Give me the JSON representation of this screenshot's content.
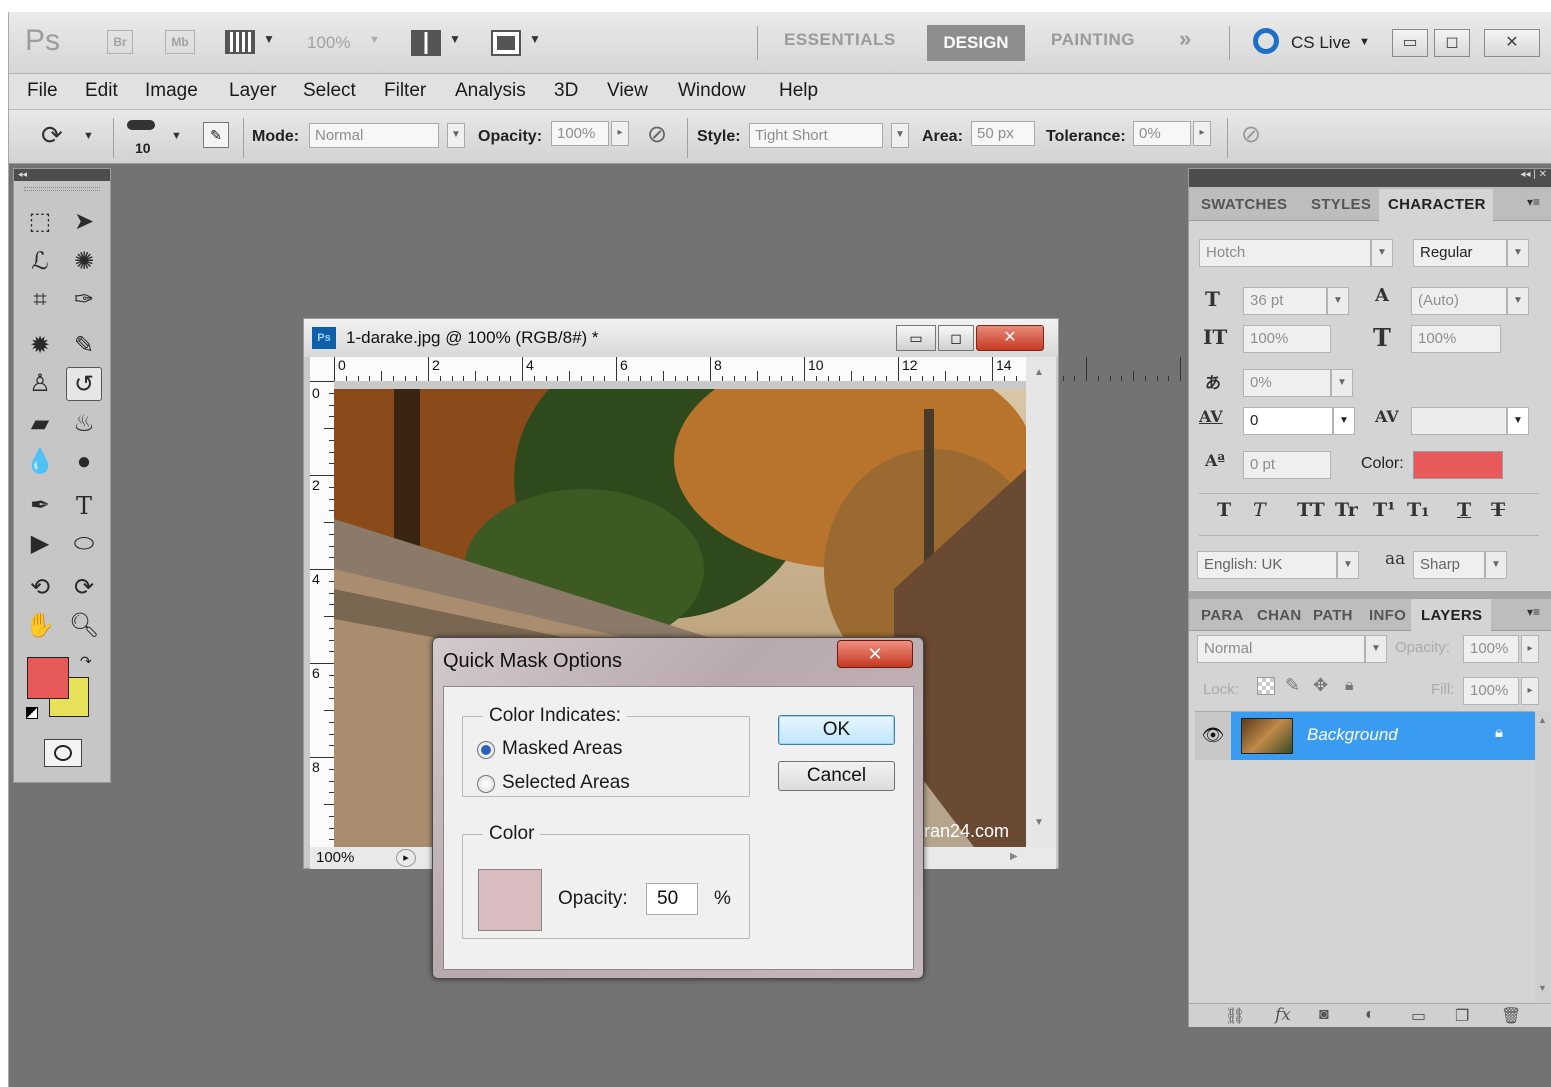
{
  "appbar": {
    "logo": "Ps",
    "bridge": "Br",
    "minibridge": "Mb",
    "zoom": "100%",
    "workspaces": [
      "ESSENTIALS",
      "DESIGN",
      "PAINTING"
    ],
    "more": "»",
    "cslive": "CS Live"
  },
  "menu": [
    "File",
    "Edit",
    "Image",
    "Layer",
    "Select",
    "Filter",
    "Analysis",
    "3D",
    "View",
    "Window",
    "Help"
  ],
  "options": {
    "brush_size": "10",
    "mode_label": "Mode:",
    "mode_value": "Normal",
    "opacity_label": "Opacity:",
    "opacity_value": "100%",
    "style_label": "Style:",
    "style_value": "Tight Short",
    "area_label": "Area:",
    "area_value": "50 px",
    "tolerance_label": "Tolerance:",
    "tolerance_value": "0%"
  },
  "document": {
    "title": "1-darake.jpg @ 100% (RGB/8#) *",
    "zoom": "100%",
    "ruler_h": [
      "0",
      "2",
      "4",
      "6",
      "8",
      "10",
      "12",
      "14"
    ],
    "ruler_v": [
      "0",
      "2",
      "4",
      "6",
      "8"
    ],
    "watermark": "ran24.com"
  },
  "dialog": {
    "title": "Quick Mask Options",
    "group1": "Color Indicates:",
    "opt_masked": "Masked Areas",
    "opt_selected": "Selected Areas",
    "group2": "Color",
    "opacity_label": "Opacity:",
    "opacity_value": "50",
    "percent": "%",
    "ok": "OK",
    "cancel": "Cancel",
    "swatch_color": "#d9bcbf"
  },
  "colors": {
    "foreground": "#e85a5a",
    "background": "#e8e25a",
    "char_color": "#e85a5a",
    "layer_selected": "#3a9cf0"
  },
  "character": {
    "tabs": [
      "SWATCHES",
      "STYLES",
      "CHARACTER"
    ],
    "font_family": "Hotch",
    "font_style": "Regular",
    "size": "36 pt",
    "leading": "(Auto)",
    "vscale": "100%",
    "hscale": "100%",
    "tsume": "0%",
    "tracking": "0",
    "baseline": "0 pt",
    "color_label": "Color:",
    "language": "English: UK",
    "aa_icon": "aa",
    "antialias": "Sharp"
  },
  "layers": {
    "tabs": [
      "PARA",
      "CHAN",
      "PATH",
      "INFO",
      "LAYERS"
    ],
    "blend": "Normal",
    "opacity_label": "Opacity:",
    "opacity": "100%",
    "lock_label": "Lock:",
    "fill_label": "Fill:",
    "fill": "100%",
    "layer_name": "Background"
  }
}
